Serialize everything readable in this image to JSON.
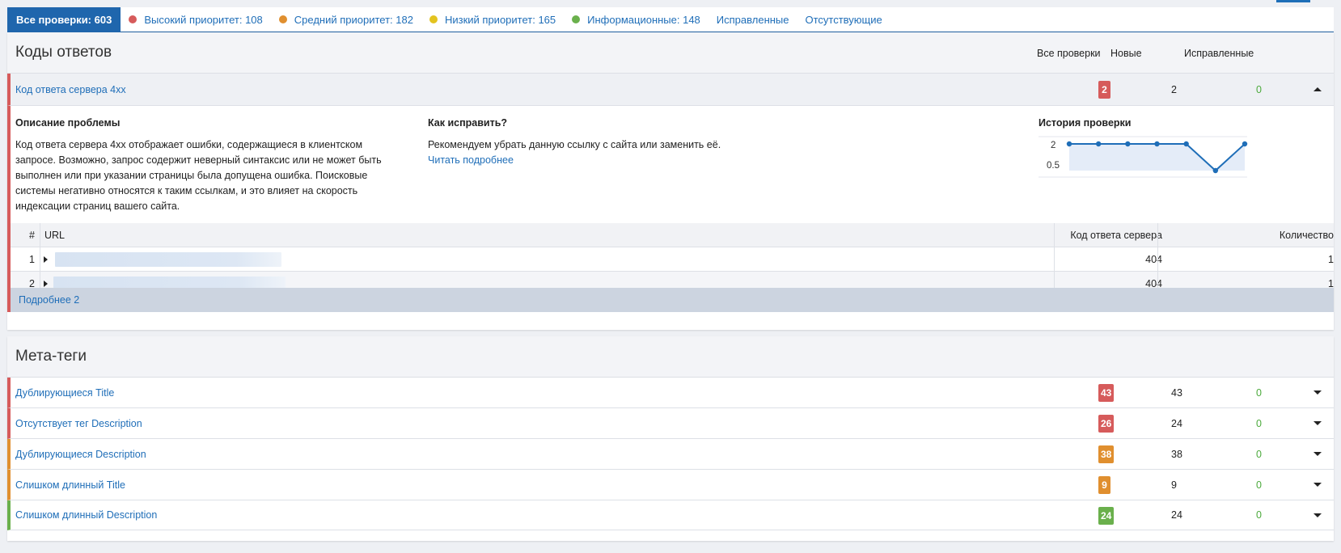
{
  "tabs": [
    {
      "label": "Все проверки: 603",
      "active": true
    },
    {
      "label": "Высокий приоритет: 108",
      "dot": "#d65b5b"
    },
    {
      "label": "Средний приоритет: 182",
      "dot": "#e08f2f"
    },
    {
      "label": "Низкий приоритет: 165",
      "dot": "#e3c31f"
    },
    {
      "label": "Информационные: 148",
      "dot": "#6ab04c"
    },
    {
      "label": "Исправленные"
    },
    {
      "label": "Отсутствующие"
    }
  ],
  "columns": {
    "all": "Все проверки",
    "new": "Новые",
    "fixed": "Исправленные"
  },
  "section1": {
    "title": "Коды ответов",
    "issue": {
      "name": "Код ответа сервера 4xx",
      "all": "2",
      "new": "2",
      "fixed": "0",
      "badge_color": "#d65b5b"
    },
    "detail": {
      "desc_title": "Описание проблемы",
      "desc_text": "Код ответа сервера 4xx отображает ошибки, содержащиеся в клиентском запросе. Возможно, запрос содержит неверный синтаксис или не может быть выполнен или при указании страницы была допущена ошибка. Поисковые системы негативно относятся к таким ссылкам, и это влияет на скорость индексации страниц вашего сайта.",
      "fix_title": "Как исправить?",
      "fix_text": "Рекомендуем убрать данную ссылку с сайта или заменить её.",
      "fix_link": "Читать подробнее",
      "history_title": "История проверки"
    },
    "table": {
      "headers": {
        "num": "#",
        "url": "URL",
        "code": "Код ответа сервера",
        "qty": "Количество"
      },
      "rows": [
        {
          "num": "1",
          "code": "404",
          "qty": "1"
        },
        {
          "num": "2",
          "code": "404",
          "qty": "1"
        }
      ]
    },
    "more": "Подробнее 2"
  },
  "history_chart": {
    "y_ticks": [
      "2",
      "0.5"
    ],
    "values": [
      2,
      2,
      2,
      2,
      2,
      0.5,
      2
    ]
  },
  "section2": {
    "title": "Мета-теги",
    "issues": [
      {
        "name": "Дублирующиеся Title",
        "all": "43",
        "new": "43",
        "fixed": "0",
        "color": "red"
      },
      {
        "name": "Отсутствует тег Description",
        "all": "26",
        "new": "24",
        "fixed": "0",
        "color": "red"
      },
      {
        "name": "Дублирующиеся Description",
        "all": "38",
        "new": "38",
        "fixed": "0",
        "color": "orange"
      },
      {
        "name": "Слишком длинный Title",
        "all": "9",
        "new": "9",
        "fixed": "0",
        "color": "orange"
      },
      {
        "name": "Слишком длинный Description",
        "all": "24",
        "new": "24",
        "fixed": "0",
        "color": "green"
      }
    ]
  },
  "colors": {
    "red": "#d65b5b",
    "orange": "#e08f2f",
    "green": "#6ab04c",
    "link": "#1f6eb8"
  }
}
